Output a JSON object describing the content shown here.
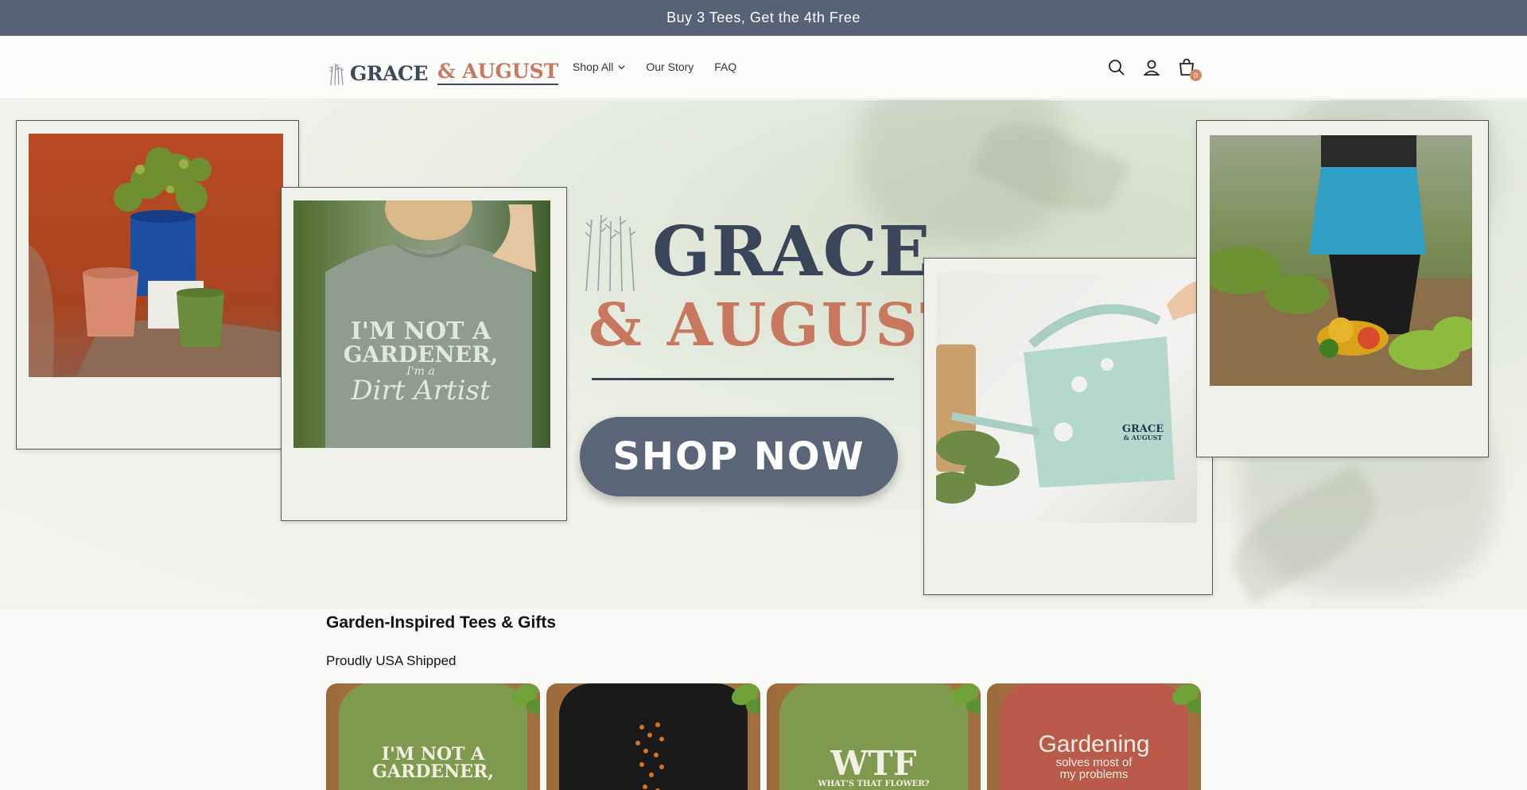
{
  "announcement": {
    "text": "Buy 3 Tees, Get the 4th Free"
  },
  "header": {
    "logo": {
      "grace": "GRACE",
      "amp": "& AUGUST"
    },
    "nav": [
      {
        "label": "Shop All",
        "has_dropdown": true
      },
      {
        "label": "Our Story",
        "has_dropdown": false
      },
      {
        "label": "FAQ",
        "has_dropdown": false
      }
    ],
    "icons": [
      "search-icon",
      "account-icon",
      "cart-icon"
    ],
    "cart_count": "0"
  },
  "hero": {
    "logo_grace": "GRACE",
    "logo_amp": "& AUGUST",
    "cta_label": "SHOP NOW",
    "tee_print": {
      "line1": "I'M NOT A",
      "line2": "GARDENER,",
      "line3": "I'm a",
      "line4": "Dirt Artist"
    },
    "can_print": {
      "line1": "GRACE",
      "line2": "& AUGUST"
    }
  },
  "section": {
    "title": "Garden-Inspired Tees & Gifts",
    "subtitle": "Proudly USA Shipped"
  },
  "products": [
    {
      "color": "#7f9a4e",
      "print_lines": [
        "I'M NOT A",
        "GARDENER,"
      ],
      "print_size": 22
    },
    {
      "color": "#1a1a1a",
      "print_lines": [
        "",
        ""
      ],
      "print_size": 22
    },
    {
      "color": "#7f9a4e",
      "print_lines": [
        "WTF",
        "WHAT'S THAT FLOWER?"
      ],
      "print_size": 40
    },
    {
      "color": "#b95a4a",
      "print_lines": [
        "Gardening",
        "solves most of",
        "my problems"
      ],
      "print_size": 30
    }
  ],
  "colors": {
    "announcement_bg": "#566275",
    "navy": "#3a4559",
    "terracotta": "#c8785e",
    "cta_bg": "#5a6577"
  }
}
